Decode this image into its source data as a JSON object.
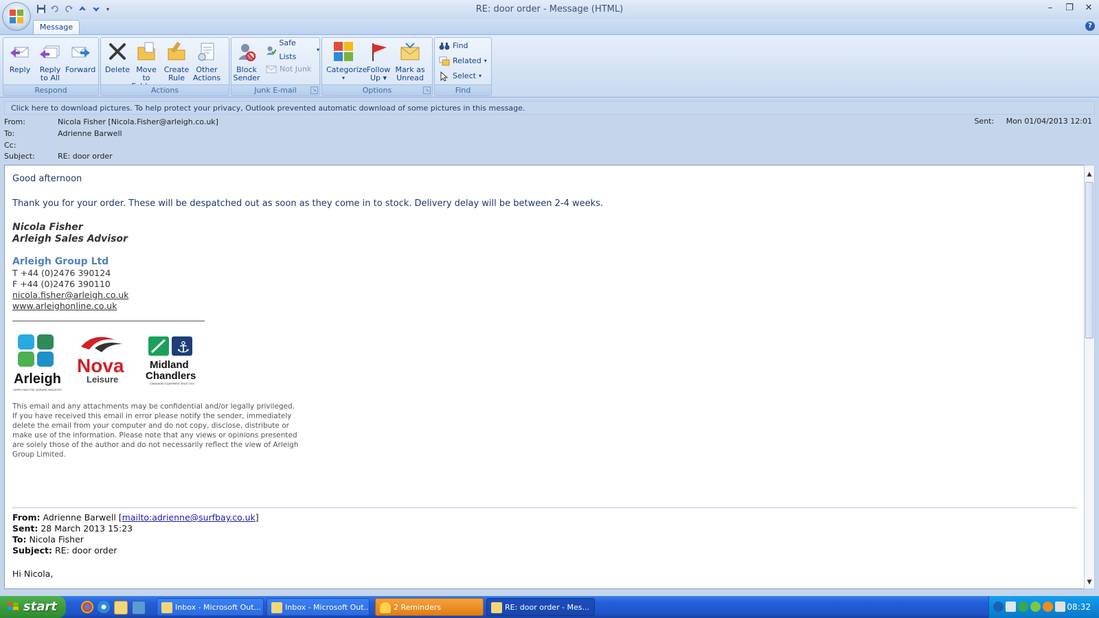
{
  "window": {
    "title": "RE: door order - Message (HTML)",
    "controls": [
      "–",
      "❐",
      "✕"
    ]
  },
  "ribbon": {
    "tab": "Message",
    "groups": {
      "respond": {
        "label": "Respond",
        "reply": "Reply",
        "reply_all_1": "Reply",
        "reply_all_2": "to All",
        "forward": "Forward"
      },
      "actions": {
        "label": "Actions",
        "delete": "Delete",
        "move_1": "Move to",
        "move_2": "Folder",
        "rule_1": "Create",
        "rule_2": "Rule",
        "other_1": "Other",
        "other_2": "Actions"
      },
      "junk": {
        "label": "Junk E-mail",
        "block_1": "Block",
        "block_2": "Sender",
        "safe_lists": "Safe Lists",
        "not_junk": "Not Junk"
      },
      "options": {
        "label": "Options",
        "categorize": "Categorize",
        "follow_1": "Follow",
        "follow_2": "Up",
        "mark_1": "Mark as",
        "mark_2": "Unread"
      },
      "find": {
        "label": "Find",
        "find": "Find",
        "related": "Related",
        "select": "Select"
      }
    }
  },
  "infobar": "Click here to download pictures. To help protect your privacy, Outlook prevented automatic download of some pictures in this message.",
  "header": {
    "from_label": "From:",
    "from": "Nicola Fisher [Nicola.Fisher@arleigh.co.uk]",
    "to_label": "To:",
    "to": "Adrienne Barwell",
    "cc_label": "Cc:",
    "subject_label": "Subject:",
    "subject": "RE: door order",
    "sent_label": "Sent:",
    "sent": "Mon 01/04/2013 12:01"
  },
  "message": {
    "greeting": "Good afternoon",
    "paragraph": "Thank you for your order.  These will be despatched out as soon as they come in to stock.  Delivery delay will be between 2-4 weeks.",
    "signature_name": "Nicola Fisher",
    "signature_title": "Arleigh Sales Advisor",
    "company": "Arleigh Group Ltd",
    "phone": "T +44 (0)2476 390124",
    "fax": "F +44 (0)2476 390110",
    "email": "nicola.fisher@arleigh.co.uk",
    "website": "www.arleighonline.co.uk",
    "logos": {
      "arleigh": "Arleigh",
      "arleigh_tag": "SUPPLYING THE LEISURE INDUSTRY",
      "nova_1": "Nova",
      "nova_2": "Leisure",
      "midland_1": "Midland",
      "midland_2": "Chandlers",
      "midland_tag": "CANALBOAT EQUIPMENT SINCE 1976"
    },
    "disclaimer": "This email and any attachments may be confidential and/or legally privileged. If you have received this email in error please notify the sender, immediately delete the email from your computer and do not copy, disclose, distribute or make use of the information. Please note that any views or opinions presented are solely those of the author and do not necessarily reflect the view of Arleigh Group Limited."
  },
  "quoted": {
    "from_label": "From:",
    "from_name": "Adrienne Barwell",
    "from_link": "mailto:adrienne@surfbay.co.uk",
    "sent_label": "Sent:",
    "sent": "28 March 2013 15:23",
    "to_label": "To:",
    "to": "Nicola Fisher",
    "subject_label": "Subject:",
    "subject": "RE: door order",
    "greeting": "Hi Nicola,"
  },
  "taskbar": {
    "start": "start",
    "buttons": [
      "Inbox - Microsoft Out...",
      "Inbox - Microsoft Out...",
      "2 Reminders",
      "RE: door order - Mes..."
    ],
    "clock": "08:32"
  }
}
